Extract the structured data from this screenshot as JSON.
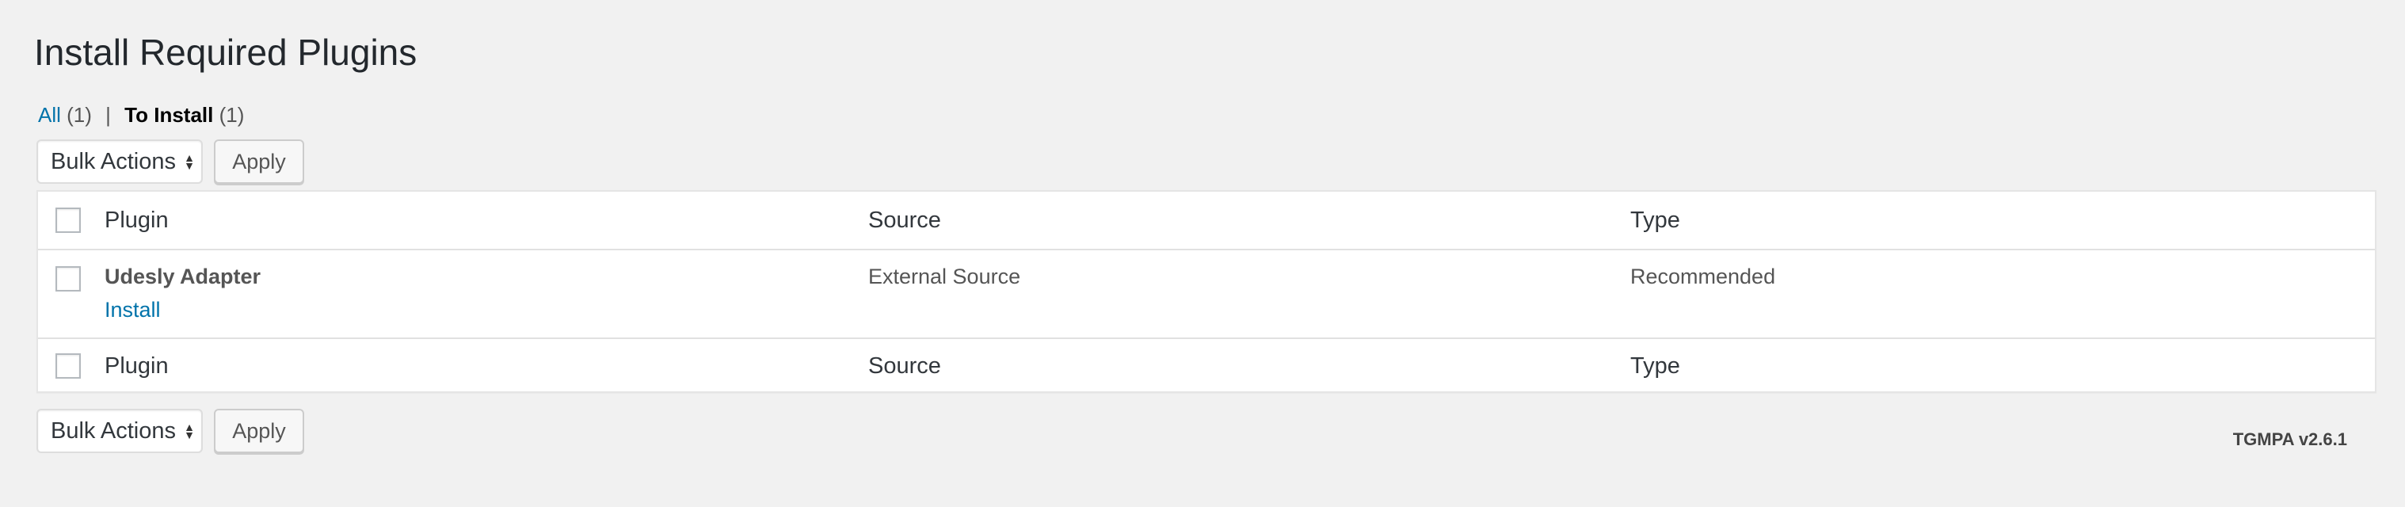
{
  "page": {
    "title": "Install Required Plugins"
  },
  "views": {
    "all": {
      "label": "All",
      "count": "(1)"
    },
    "separator": "|",
    "to_install": {
      "label": "To Install",
      "count": "(1)"
    }
  },
  "bulk_actions": {
    "select_label": "Bulk Actions",
    "apply_label": "Apply"
  },
  "table": {
    "columns": [
      "Plugin",
      "Source",
      "Type"
    ],
    "rows": [
      {
        "plugin": "Udesly Adapter",
        "action": "Install",
        "source": "External Source",
        "type": "Recommended"
      }
    ]
  },
  "footer": {
    "version": "TGMPA v2.6.1"
  },
  "colors": {
    "background": "#f1f1f1",
    "link": "#0073aa",
    "text": "#23282d"
  },
  "icons": {
    "select_arrows": "select-arrows-icon"
  }
}
